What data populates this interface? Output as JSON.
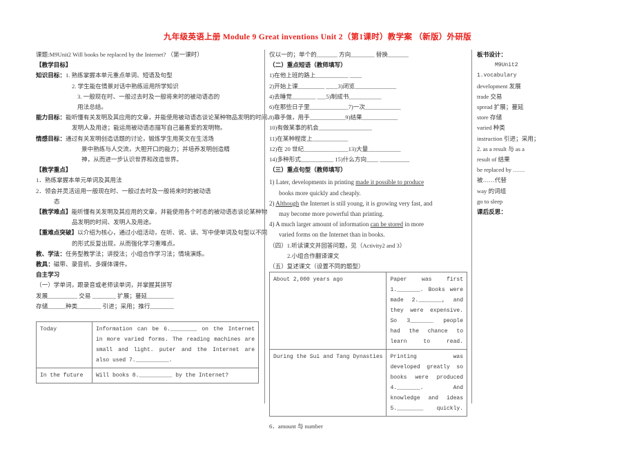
{
  "document": {
    "title": "九年级英语上册 Module 9 Great inventions Unit 2（第1课时）教学案 （新版）外研版",
    "title_color": "#e8201b"
  },
  "left_column": {
    "topic_line": "课题:M9Unit2 Will books be replaced by the Internet?  （第一课时）",
    "teaching_goals_heading": "【教学目标】",
    "knowledge_label": "知识目标：",
    "knowledge_items": [
      "1. 熟练掌握本单元重点单词、短语及句型",
      "2. 学生能在情景对话中熟练运用所学知识",
      "3. 一般现在时、一般过去时及一般将来时的被动语态的",
      "用法总结。"
    ],
    "ability_label": "能力目标：",
    "ability_lines": [
      "能听懂有关发明及其应用的文章，并能使用被动语态谈论某种物品发明的时间、",
      "发明人及用途；能运用被动语态描写自己最喜爱的发明物。"
    ],
    "emotion_label": "情感目标：",
    "emotion_lines": [
      "通过有关发明创造话题的讨论，锻炼学生用英文在生活场",
      "景中熟练与人交流，大胆开口的能力；并培养发明创造精",
      "神，从而进一步认识世界和改造世界。"
    ],
    "key_points_heading": "【教学重点】",
    "key_points": [
      "1．熟练掌握本单元单词及其用法",
      "2．领会并灵活运用一般现在时、一般过去时及一般将来时的被动语",
      "态"
    ],
    "difficulty_label": "【教学难点】",
    "difficulty_lines": [
      "能听懂有关发明及其应用的文章，并能使用各个时态的被动语态谈论某种物",
      "品发明的时间、发明人及用途。"
    ],
    "breakthrough_label": "【重难点突破】",
    "breakthrough_lines": [
      "以介绍为核心，通过小组活动，在听、说、读、写中使单词及句型以不同",
      "的形式反复出现，从而强化学习重难点。"
    ],
    "methods_label": "教、学法：",
    "methods_text": "任务型教学法；讲授法；小组合作学习法；情境演练。",
    "aids_label": "教具：",
    "aids_text": "磁带、录音机、多媒体课件。",
    "self_study_heading": "自主学习",
    "vocab_instruction": "（一）学单词，跟录音或老师读单词，并掌握其拼写",
    "vocab_line1": "发展__________  交易 ________  扩展；蔓延_________",
    "vocab_line2": "存储______种类________  引进；采用；推行________",
    "table": {
      "rows": [
        {
          "label": "Today",
          "content": "Information can be 6.________ on the Internet in more varied forms. The reading machines are small and light. puter and the Internet are also used 7.__________."
        },
        {
          "label": "In the future",
          "content": "Will books 8.__________ by the Internet?"
        }
      ]
    }
  },
  "mid_column": {
    "vocab_tail": "仅以一的；单个的_______  方向________  替换_______",
    "phrases_heading": "（二）重点短语（教师填写）",
    "phrases": [
      "1)在他上班的路上___________  ____",
      "2)开始上课_________  ____3)闭览______________",
      "4)去睡觉________  ___5)制成书___________",
      "6)在那些日子里_____________7)一次____________",
      "8)靠手做，用手____________9)结果____________",
      "10)有做某事的机会__________________",
      "11)在某种程度上____________",
      "12)在 20 世纪_______________13)大量___________",
      "14)多种形式___________ 15)什么方向____ __________"
    ],
    "sentences_heading": "（三）重点句型（教师填写）",
    "sentences": [
      {
        "num": "1)",
        "parts": [
          {
            "t": "Later, developments in printing ",
            "u": false
          },
          {
            "t": "made",
            "u": true
          },
          {
            "t": " it possible to produce",
            "u": false
          }
        ],
        "cont": "books more quickly and cheaply."
      },
      {
        "num": "2)",
        "parts": [
          {
            "t": "Although",
            "u": true
          },
          {
            "t": " the Internet is still young, it is growing very fast, and",
            "u": false
          }
        ],
        "cont": "may become more powerful than printing."
      },
      {
        "num": "4)",
        "parts": [
          {
            "t": "A much larger amount of information ",
            "u": false
          },
          {
            "t": "can be stored",
            "u": true
          },
          {
            "t": " in more",
            "u": false
          }
        ],
        "cont": "varied forms on the Internet than in books."
      }
    ],
    "section_four_line1": "（四）1.听读课文并回答问题，见（Activity2 and 3）",
    "section_four_line2": "2.小组合作翻译课文",
    "section_five_heading": "（五）复述课文（设置不同的题型）",
    "table": {
      "rows": [
        {
          "label": "About 2,000 years ago",
          "content": "Paper was first 1._______.  Books were made 2._______, and they were expensive. So 3_______ people had the chance to learn to read."
        },
        {
          "label": "During the Sui and Tang Dynasties",
          "content": "Printing was developed greatly so books were produced 4._______.  And knowledge and ideas 5.________ quickly."
        }
      ]
    },
    "note_line": "6．amount 与 number"
  },
  "right_column": {
    "heading": "板书设计：",
    "unit": "M9Unit2",
    "vocab_heading": "1.vocabulary",
    "vocab_items": [
      "development 发展",
      "trade 交易",
      "spread 扩展；蔓延",
      "store 存储",
      "varied 种类",
      "instruction 引进；采用；"
    ],
    "phrase_heading": "2. as a result 与 as a",
    "phrase_items": [
      "result of 结果",
      "be replaced by ……",
      "被……代替",
      "way 的词组",
      "go to sleep"
    ],
    "reflection": "课后反思："
  }
}
